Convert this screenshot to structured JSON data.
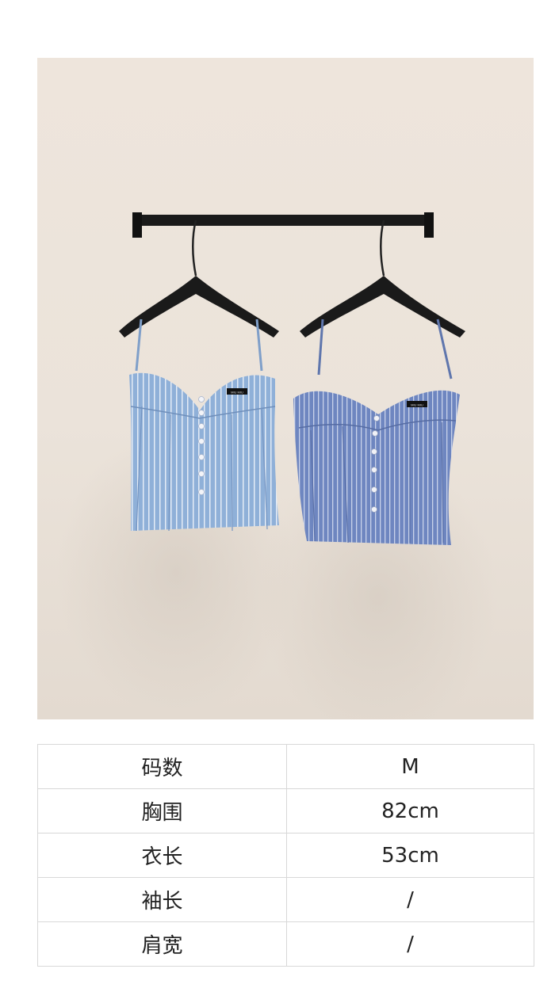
{
  "photo": {
    "logo_text": "MIU MIU"
  },
  "colors": {
    "wall": "#ebe3da",
    "top_left": "#8fb0d8",
    "top_right": "#6e86c0",
    "hanger": "#1a1a1a"
  },
  "spec_table": {
    "rows": [
      {
        "label": "码数",
        "value": "M"
      },
      {
        "label": "胸围",
        "value": "82cm"
      },
      {
        "label": "衣长",
        "value": "53cm"
      },
      {
        "label": "袖长",
        "value": "/"
      },
      {
        "label": "肩宽",
        "value": "/"
      }
    ]
  }
}
